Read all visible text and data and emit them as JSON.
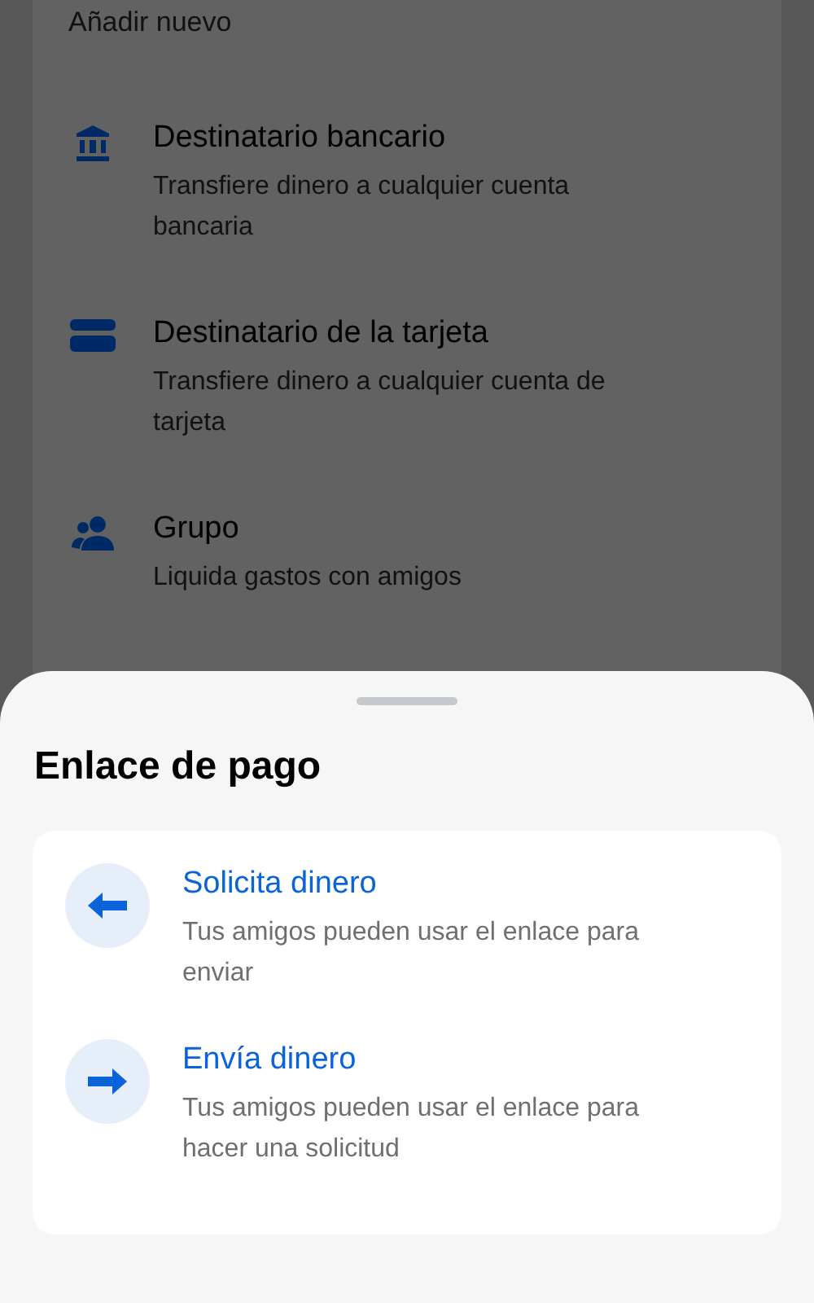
{
  "background": {
    "section_title": "Añadir nuevo",
    "items": [
      {
        "kind": "bank",
        "title": "Destinatario bancario",
        "subtitle": "Transfiere dinero a cualquier cuenta bancaria"
      },
      {
        "kind": "card",
        "title": "Destinatario de la tarjeta",
        "subtitle": "Transfiere dinero a cualquier cuenta de tarjeta"
      },
      {
        "kind": "group",
        "title": "Grupo",
        "subtitle": "Liquida gastos con amigos"
      }
    ]
  },
  "sheet": {
    "title": "Enlace de pago",
    "options": [
      {
        "kind": "left",
        "title": "Solicita dinero",
        "subtitle": "Tus amigos pueden usar el enlace para enviar"
      },
      {
        "kind": "right",
        "title": "Envía dinero",
        "subtitle": "Tus amigos pueden usar el enlace para hacer una solicitud"
      }
    ]
  }
}
